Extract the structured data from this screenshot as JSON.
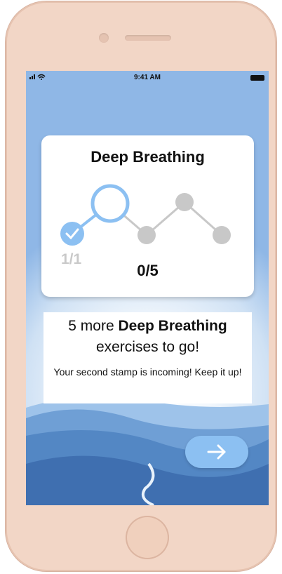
{
  "status_bar": {
    "time": "9:41 AM"
  },
  "card": {
    "title": "Deep Breathing",
    "completed_label": "1/1",
    "progress_label": "0/5"
  },
  "message": {
    "line1_prefix": "5 more ",
    "line1_bold": "Deep Breathing",
    "line2": "exercises to go!",
    "subtext": "Your second stamp is incoming! Keep it up!"
  },
  "next_button": {
    "icon": "arrow-right-icon"
  },
  "colors": {
    "sky": "#8fb7e6",
    "accent": "#8cc0f2",
    "node_active": "#8cc0f2",
    "node_inactive": "#c8c8c8",
    "phone_body": "#f2d6c6"
  }
}
